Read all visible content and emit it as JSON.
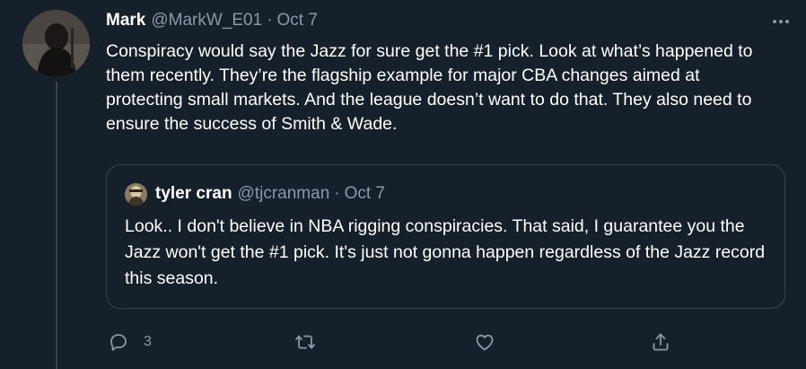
{
  "tweet": {
    "author_name": "Mark",
    "author_handle": "@MarkW_E01",
    "separator": "·",
    "date": "Oct 7",
    "text": "Conspiracy would say the Jazz for sure get the #1 pick. Look at what’s happened to them recently. They’re the flagship example for major CBA changes aimed at protecting small markets. And the league doesn’t want to do that. They also need to ensure the success of Smith & Wade.",
    "more_icon": "more-horizontal-icon"
  },
  "quoted_tweet": {
    "author_name": "tyler cran",
    "author_handle": "@tjcranman",
    "separator": "·",
    "date": "Oct 7",
    "text": "Look.. I don't believe in NBA rigging conspiracies. That said, I guarantee you the Jazz won't get the #1 pick. It's just not gonna happen regardless of the Jazz record this season."
  },
  "actions": {
    "reply_count": "3",
    "retweet_count": "",
    "like_count": "",
    "reply_icon": "reply-icon",
    "retweet_icon": "retweet-icon",
    "like_icon": "heart-icon",
    "share_icon": "share-icon"
  },
  "colors": {
    "background": "#15202b",
    "secondary_text": "#8b98a5",
    "border": "#38444d",
    "primary_text": "#ffffff"
  }
}
